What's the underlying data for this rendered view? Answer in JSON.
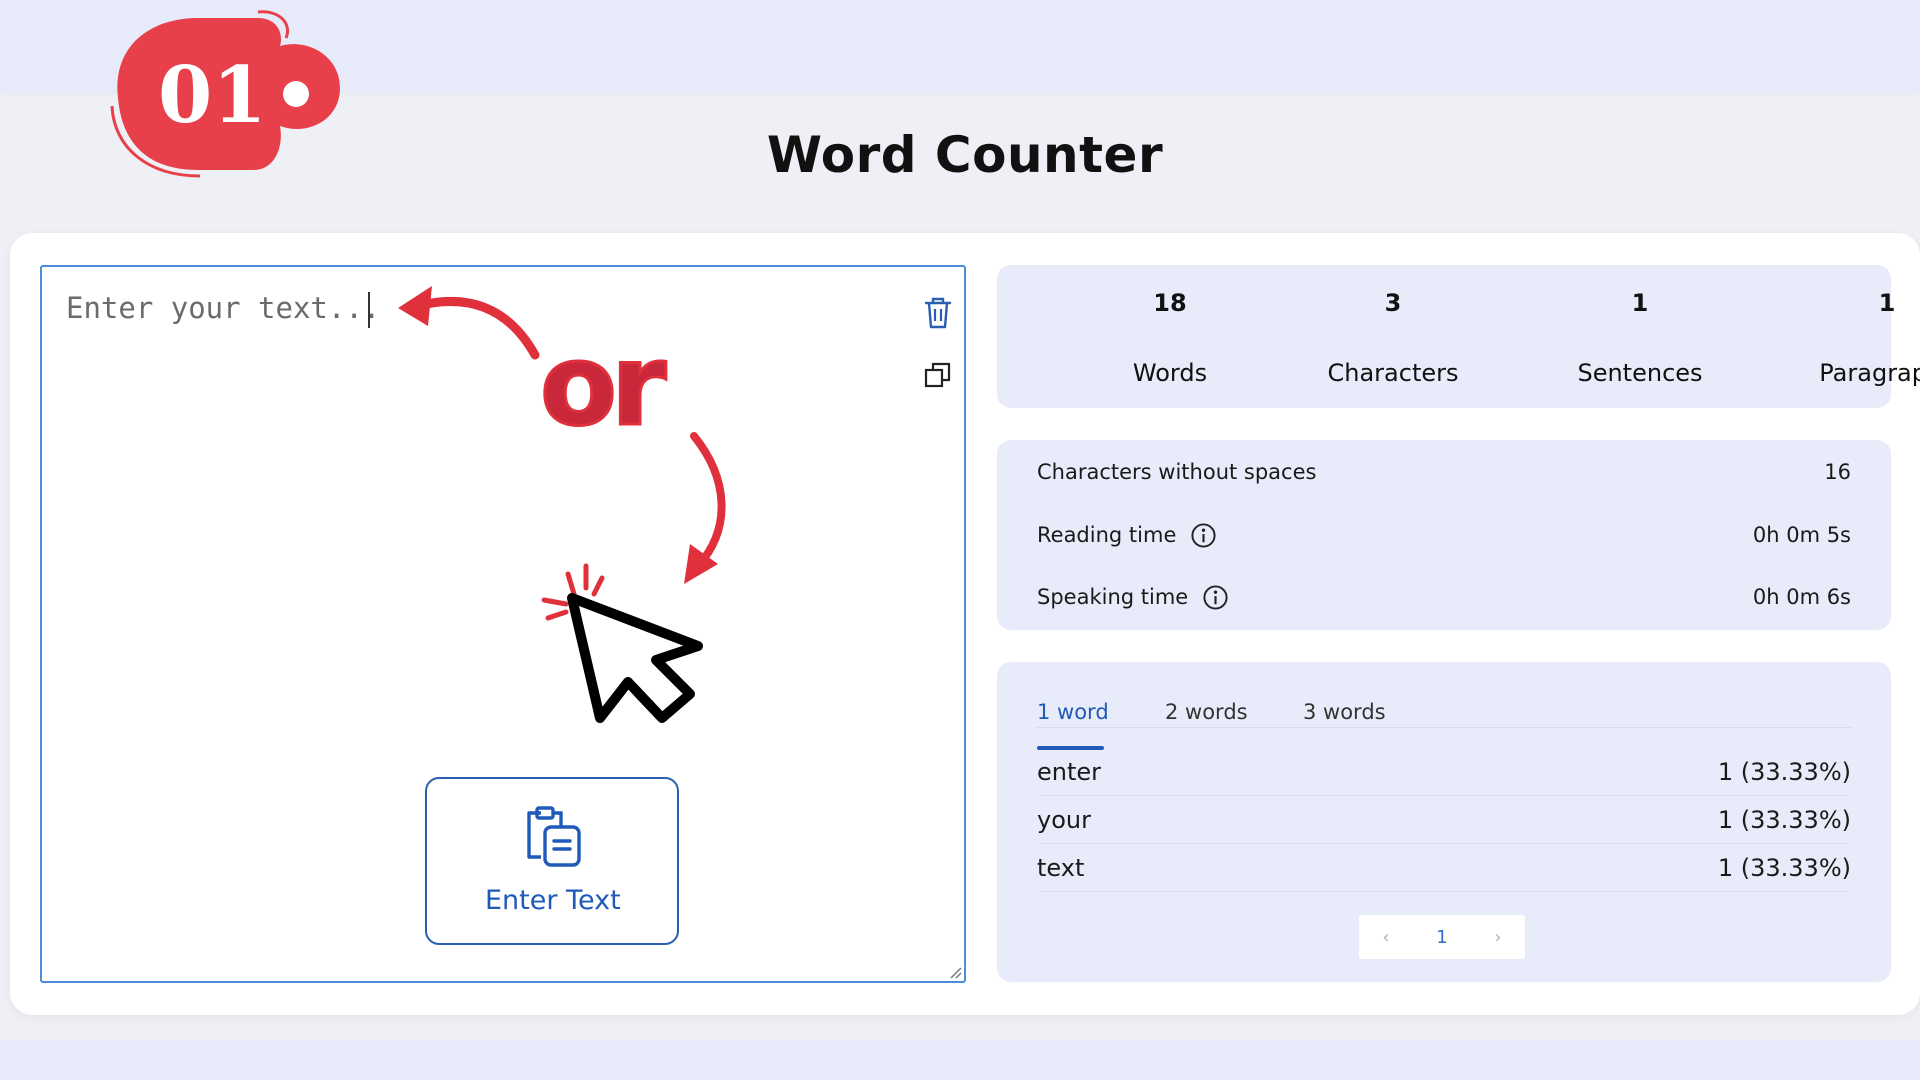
{
  "page": {
    "title": "Word Counter"
  },
  "step_badge": {
    "label": "01",
    "color": "#e8404a"
  },
  "editor": {
    "placeholder": "Enter your text...",
    "trash_icon": "trash-icon",
    "copy_icon": "copy-icon",
    "enter_text_button": "Enter Text"
  },
  "annotation": {
    "or_text": "or",
    "color": "#e0303c"
  },
  "stats": [
    {
      "value": "18",
      "label": "Words"
    },
    {
      "value": "3",
      "label": "Characters"
    },
    {
      "value": "1",
      "label": "Sentences"
    },
    {
      "value": "1",
      "label": "Paragraphs"
    }
  ],
  "details": [
    {
      "label": "Characters without spaces",
      "value": "16",
      "info": false
    },
    {
      "label": "Reading time",
      "value": "0h 0m 5s",
      "info": true
    },
    {
      "label": "Speaking time",
      "value": "0h 0m 6s",
      "info": true
    }
  ],
  "density": {
    "tabs": [
      "1 word",
      "2 words",
      "3 words"
    ],
    "active_tab": "1 word",
    "rows": [
      {
        "word": "enter",
        "count": "1 (33.33%)"
      },
      {
        "word": "your",
        "count": "1 (33.33%)"
      },
      {
        "word": "text",
        "count": "1 (33.33%)"
      }
    ],
    "pager": {
      "prev": "‹",
      "current": "1",
      "next": "›"
    }
  },
  "colors": {
    "accent": "#1f5ab8",
    "panel": "#e8ecfa",
    "badge": "#e8404a"
  }
}
